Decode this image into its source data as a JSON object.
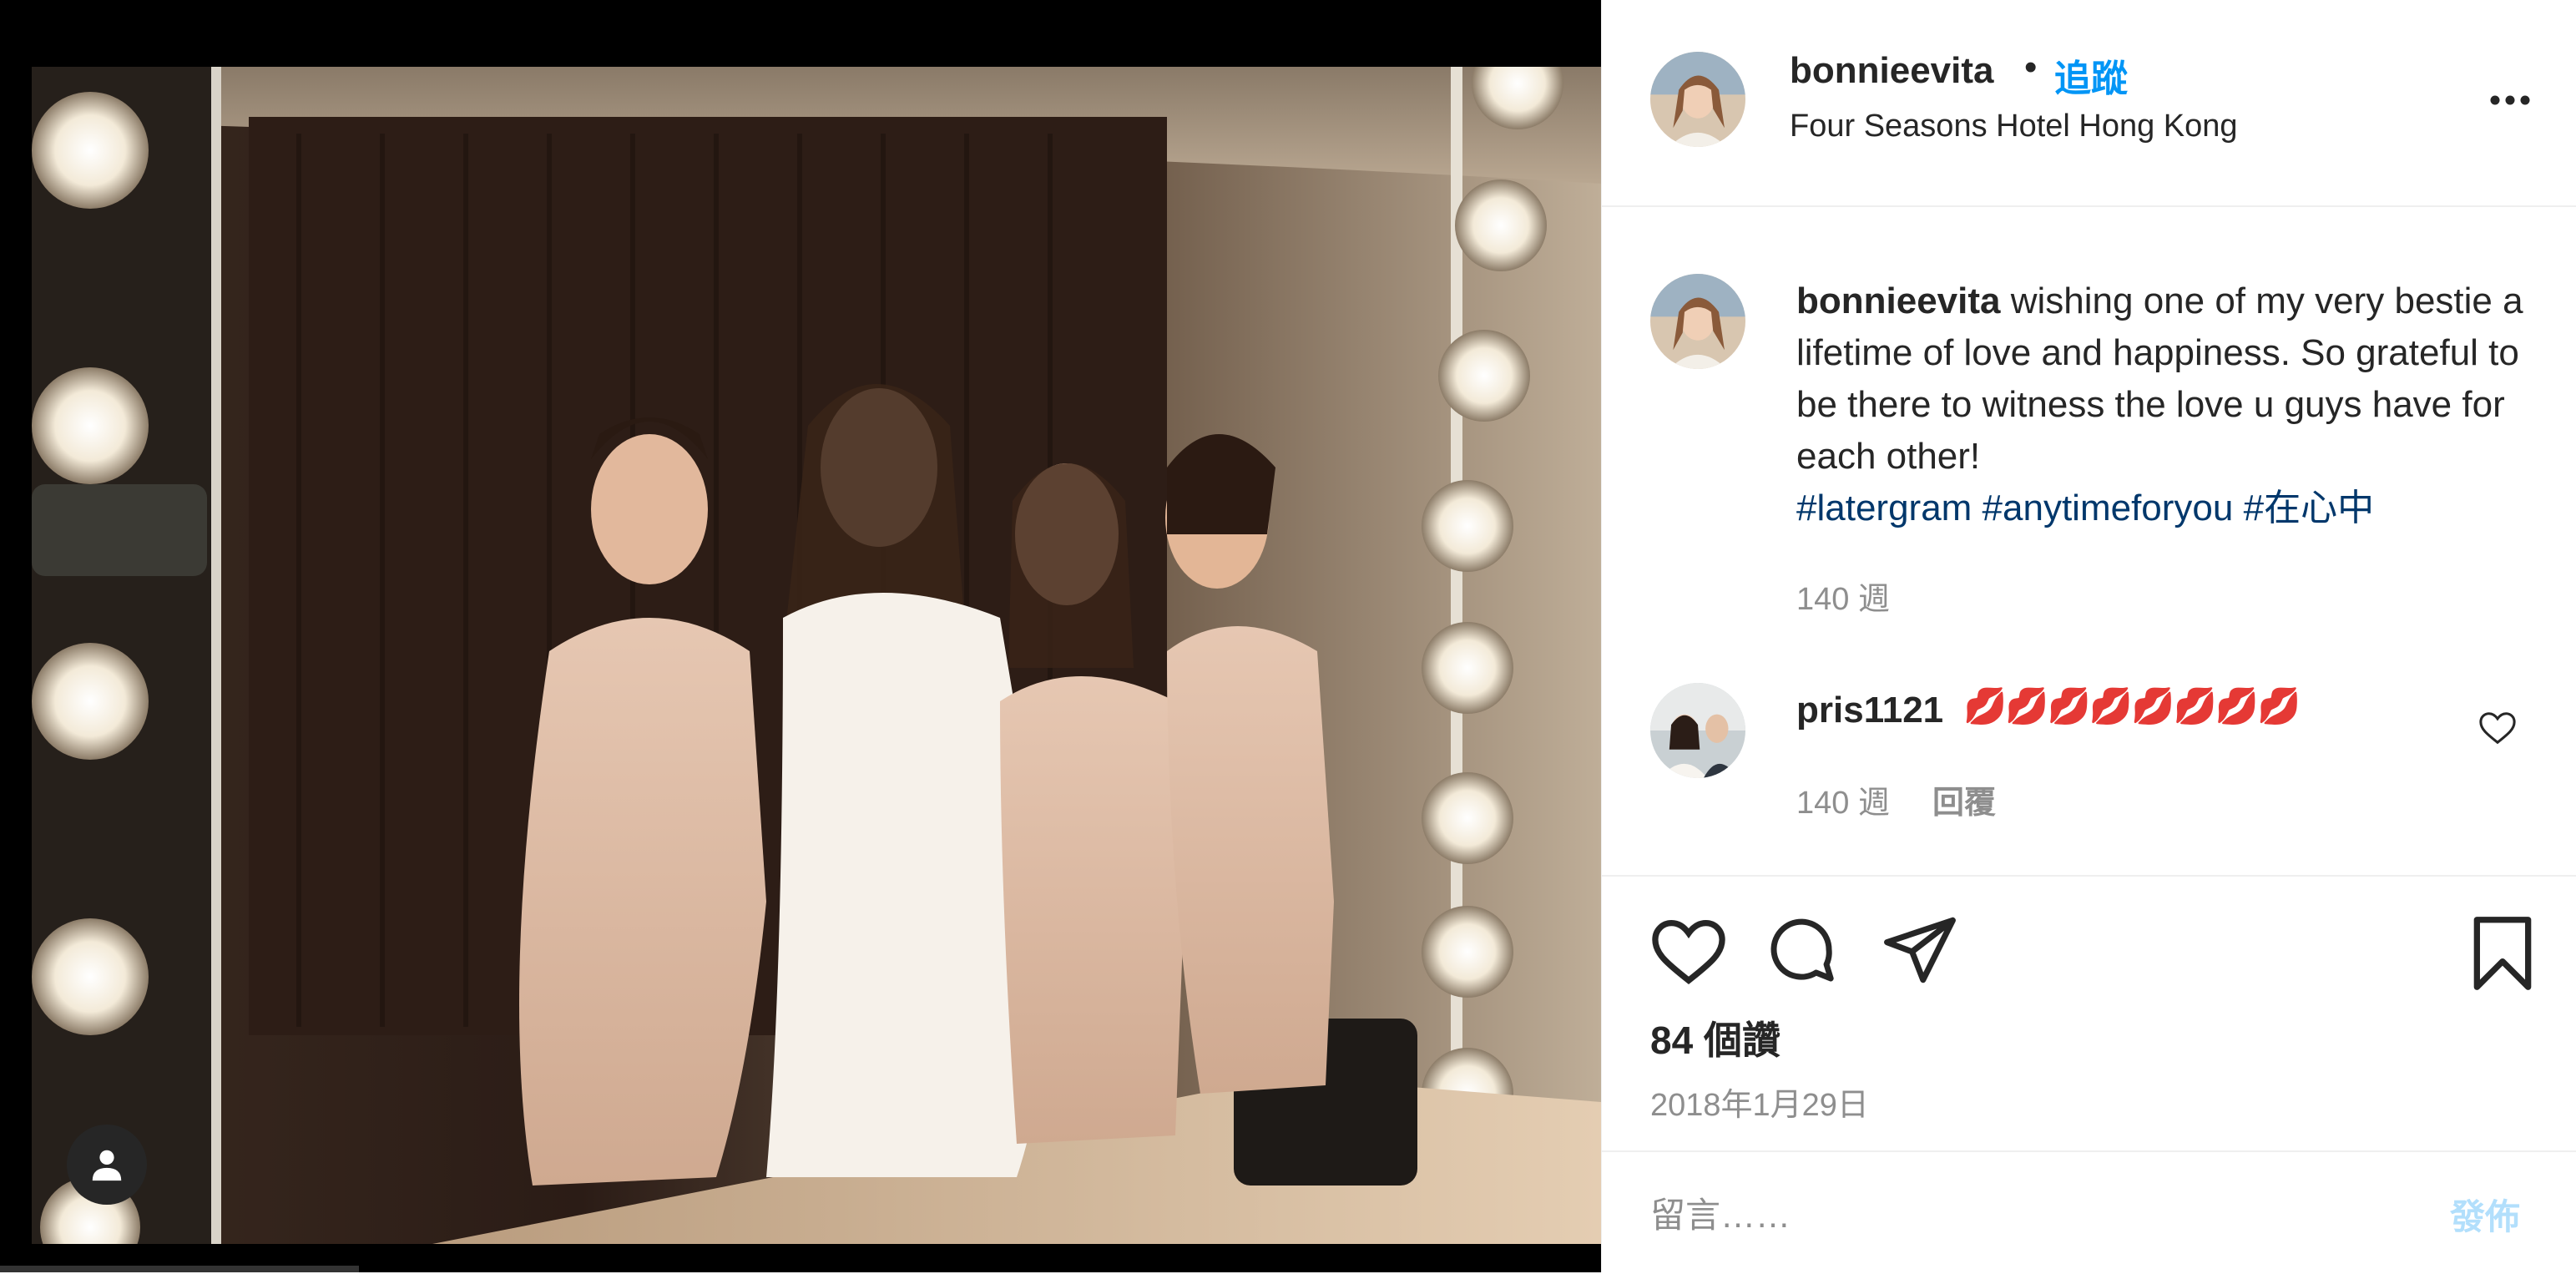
{
  "header": {
    "username": "bonnieevita",
    "separator": "•",
    "follow_label": "追蹤",
    "location": "Four Seasons Hotel Hong Kong",
    "more_icon": "more-horizontal-icon"
  },
  "caption": {
    "username": "bonnieevita",
    "text": "wishing one of my very bestie a lifetime of love and happiness. So grateful to be there to witness the love u guys have for each other!",
    "hashtags": [
      "#latergram",
      "#anytimeforyou",
      "#在心中"
    ],
    "time": "140 週"
  },
  "comments": [
    {
      "username": "pris1121",
      "text": "💋💋💋💋💋💋💋💋",
      "time": "140 週",
      "reply_label": "回覆"
    }
  ],
  "actions": {
    "like_icon": "heart-icon",
    "comment_icon": "comment-icon",
    "share_icon": "paper-plane-icon",
    "save_icon": "bookmark-icon"
  },
  "likes": "84 個讚",
  "date": "2018年1月29日",
  "comment_box": {
    "placeholder": "留言……",
    "post_label": "發佈"
  },
  "colors": {
    "link_blue": "#0095f6",
    "hashtag": "#00376b",
    "muted": "#8e8e8e",
    "post_disabled": "#b2dffc"
  }
}
